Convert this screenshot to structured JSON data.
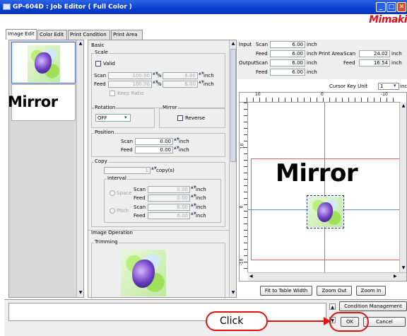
{
  "window": {
    "title": "GP-604D : Job Editor ( Full Color )",
    "logo": "Mimaki"
  },
  "tabs": [
    "Image Edit",
    "Color Edit",
    "Print Condition",
    "Print Area"
  ],
  "thumb_mirror_text": "Mirror",
  "basic": {
    "header": "Basic",
    "scale_label": "Scale",
    "valid_label": "Valid",
    "scan_label": "Scan",
    "feed_label": "Feed",
    "scan_pct": "100.00",
    "feed_pct": "100.00",
    "pct_unit": "%",
    "scan_inch": "6.00",
    "feed_inch": "6.00",
    "inch_unit": "inch",
    "keep_ratio": "Keep Ratio",
    "rotation_label": "Rotation",
    "rotation_value": "OFF",
    "mirror_label": "Mirror",
    "reverse_label": "Reverse",
    "position_label": "Position",
    "pos_scan": "0.00",
    "pos_feed": "0.00",
    "copy_label": "Copy",
    "copy_count": "1",
    "copy_unit": "copy(s)",
    "interval_label": "Interval",
    "space_label": "Space",
    "pitch_label": "Pitch",
    "space_scan": "0.00",
    "space_feed": "0.00",
    "pitch_scan": "6.00",
    "pitch_feed": "6.00",
    "image_operation": "Image Operation",
    "trimming": "Trimming"
  },
  "info": {
    "input": "Input",
    "output": "Output",
    "scan": "Scan",
    "feed": "Feed",
    "input_scan": "6.00",
    "input_feed": "6.00",
    "output_scan": "6.00",
    "output_feed": "6.00",
    "unit": "inch",
    "print_area": "Print Area",
    "pa_scan": "24.02",
    "pa_feed": "16.54",
    "cursor_key_unit": "Cursor Key Unit",
    "cursor_key_value": "1",
    "cursor_unit": "inch"
  },
  "ruler": {
    "top": [
      "10",
      "0",
      "-10"
    ],
    "left": [
      "10",
      "0",
      "-10"
    ]
  },
  "preview_mirror_text": "Mirror",
  "buttons": {
    "fit": "Fit to Table Width",
    "zoom_out": "Zoom Out",
    "zoom_in": "Zoom In",
    "condition_management": "Condition Management",
    "ok": "OK",
    "cancel": "Cancel"
  },
  "callout": "Click"
}
